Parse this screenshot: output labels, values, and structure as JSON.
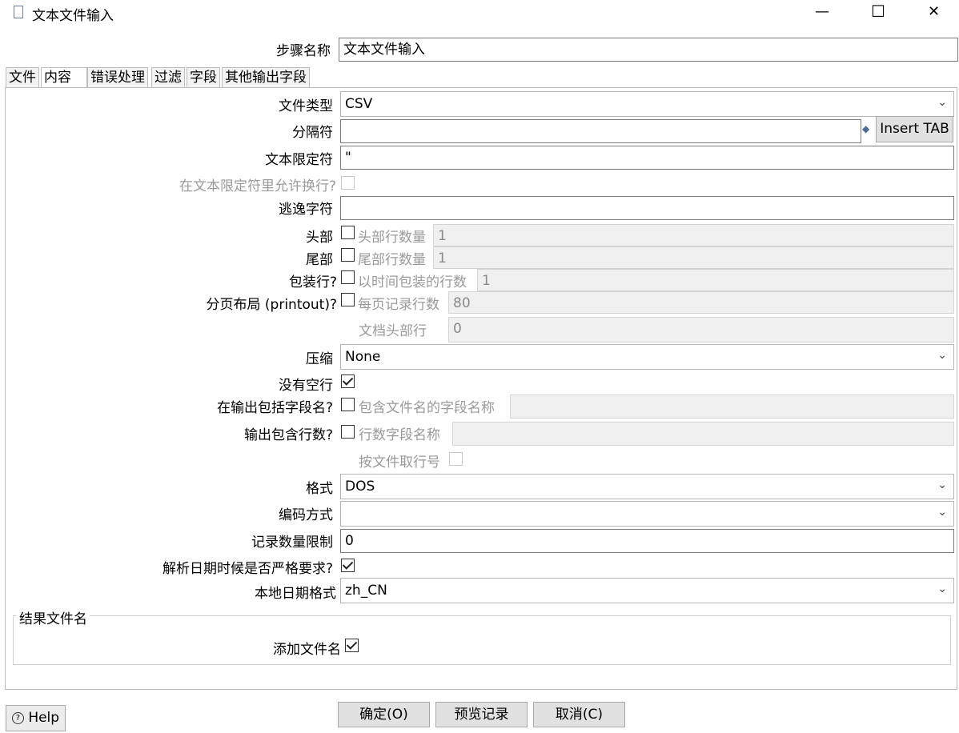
{
  "window": {
    "title": "文本文件输入",
    "minimize": "—",
    "maximize": "☐",
    "close": "✕"
  },
  "step": {
    "label": "步骤名称",
    "value": "文本文件输入"
  },
  "tabs": [
    "文件",
    "内容",
    "错误处理",
    "过滤",
    "字段",
    "其他输出字段"
  ],
  "content": {
    "file_type": {
      "label": "文件类型",
      "value": "CSV"
    },
    "separator": {
      "label": "分隔符",
      "value": "",
      "insert_tab": "Insert TAB"
    },
    "enclosure": {
      "label": "文本限定符",
      "value": "\""
    },
    "allow_breaks": {
      "label": "在文本限定符里允许换行?"
    },
    "escape": {
      "label": "逃逸字符",
      "value": ""
    },
    "header": {
      "label": "头部",
      "sub_label": "头部行数量",
      "value": "1"
    },
    "footer": {
      "label": "尾部",
      "sub_label": "尾部行数量",
      "value": "1"
    },
    "wrap": {
      "label": "包装行?",
      "sub_label": "以时间包装的行数",
      "value": "1"
    },
    "paging": {
      "label": "分页布局 (printout)?",
      "sub_label": "每页记录行数",
      "value": "80",
      "doc_header_label": "文档头部行",
      "doc_header_value": "0"
    },
    "compression": {
      "label": "压缩",
      "value": "None"
    },
    "no_empty": {
      "label": "没有空行"
    },
    "include_filename": {
      "label": "在输出包括字段名?",
      "sub_label": "包含文件名的字段名称",
      "value": ""
    },
    "include_rownum": {
      "label": "输出包含行数?",
      "sub_label": "行数字段名称",
      "value": "",
      "by_file_label": "按文件取行号"
    },
    "format": {
      "label": "格式",
      "value": "DOS"
    },
    "encoding": {
      "label": "编码方式",
      "value": ""
    },
    "limit": {
      "label": "记录数量限制",
      "value": "0"
    },
    "strict_date": {
      "label": "解析日期时候是否严格要求?"
    },
    "locale": {
      "label": "本地日期格式",
      "value": "zh_CN"
    },
    "result_group": {
      "title": "结果文件名",
      "add_label": "添加文件名"
    }
  },
  "buttons": {
    "help": "Help",
    "ok": "确定(O)",
    "preview": "预览记录",
    "cancel": "取消(C)"
  },
  "icons": {
    "chevron": "⌄",
    "variable": "◆"
  }
}
